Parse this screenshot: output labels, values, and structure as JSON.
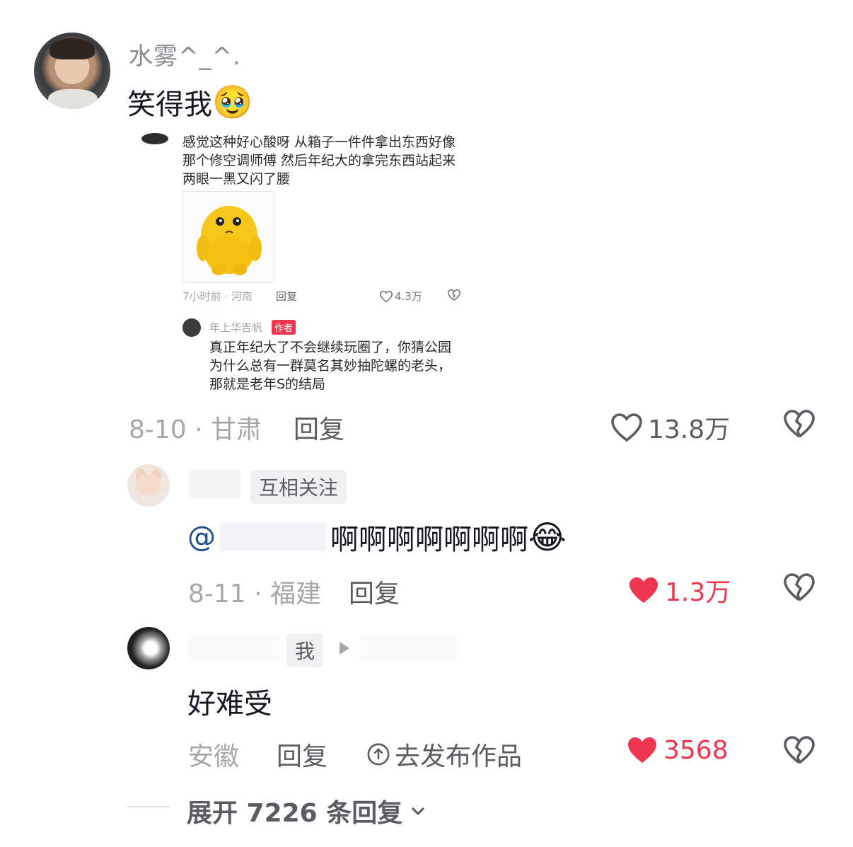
{
  "comments": [
    {
      "username": "水雾^_^.",
      "text": "笑得我",
      "emoji": "🥹",
      "date_location": "8-10 · 甘肃",
      "reply_label": "回复",
      "likes": "13.8万",
      "liked": false,
      "embedded_image": {
        "line1": "感觉这种好心酸呀  从箱子一件件拿出东西好像",
        "line2": "那个修空调师傅  然后年纪大的拿完东西站起来",
        "line3": "两眼一黑又闪了腰",
        "meta": "7小时前 · 河南",
        "reply": "回复",
        "likes": "4.3万",
        "sub_user": "年上华吉帆",
        "author_tag": "作者",
        "sub_line1": "真正年纪大了不会继续玩圈了，你猜公园",
        "sub_line2": "为什么总有一群莫名其妙抽陀螺的老头，",
        "sub_line3": "那就是老年S的结局"
      }
    },
    {
      "tag": "互相关注",
      "mention": "@",
      "text": "啊啊啊啊啊啊啊",
      "emoji": "😂",
      "date_location": "8-11 · 福建",
      "reply_label": "回复",
      "likes": "1.3万",
      "liked": true
    },
    {
      "tag": "我",
      "text": "好难受",
      "date_location": "安徽",
      "reply_label": "回复",
      "publish_label": "去发布作品",
      "likes": "3568",
      "liked": true
    }
  ],
  "expand_label": "展开 7226 条回复",
  "colors": {
    "like_red": "#ee3650",
    "gray_text": "#a6a7ab",
    "dark_text": "#161823",
    "mention_blue": "#1f4f8a"
  },
  "icons": [
    "heart-icon",
    "broken-heart-icon",
    "upload-circle-icon",
    "chevron-down-icon",
    "play-triangle-icon"
  ]
}
